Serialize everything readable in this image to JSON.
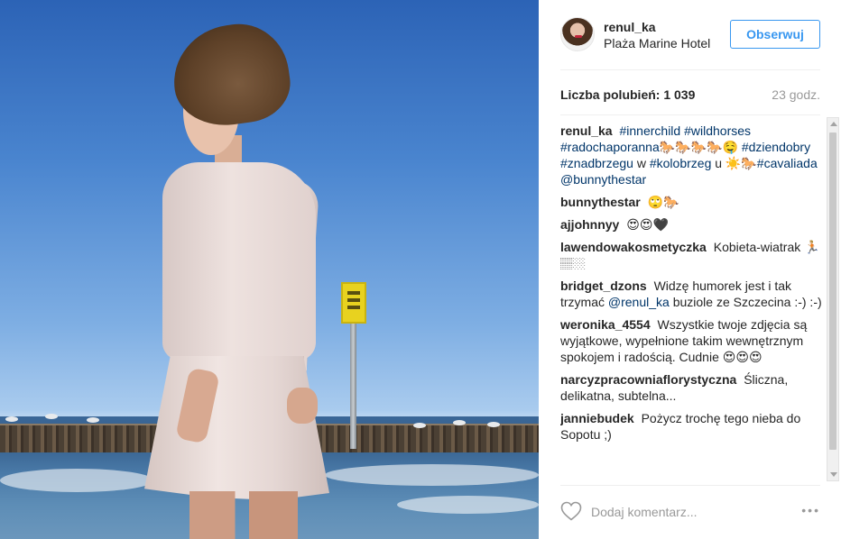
{
  "post": {
    "username": "renul_ka",
    "location": "Plaża Marine Hotel",
    "follow_label": "Obserwuj",
    "likes_text": "Liczba polubień: 1 039",
    "time_ago": "23 godz.",
    "caption": {
      "author": "renul_ka",
      "parts": [
        "#innerchild",
        "#wildhorses",
        "#radochaporanna🐎🐎🐎🐎🤤",
        "#dziendobry",
        "#znadbrzegu",
        "w",
        "#kolobrzeg",
        "u ☀️🐎",
        "#cavaliada",
        "@bunnythestar"
      ]
    }
  },
  "comments": [
    {
      "author": "bunnythestar",
      "text": "🙄🐎"
    },
    {
      "author": "ajjohnnyy",
      "text": "😍😍🖤"
    },
    {
      "author": "lawendowakosmetyczka",
      "text": "Kobieta-wiatrak 🏃🏼🏽🏼"
    },
    {
      "author": "bridget_dzons",
      "text_before": "Widzę humorek jest i tak trzymać",
      "mention": "@renul_ka",
      "text_after": "buziole ze Szczecina :-) :-)"
    },
    {
      "author": "weronika_4554",
      "text": "Wszystkie twoje zdjęcia są wyjątkowe, wypełnione takim wewnętrznym spokojem i radością. Cudnie 😍😍😍"
    },
    {
      "author": "narcyzpracowniaflorystyczna",
      "text": "Śliczna, delikatna, subtelna..."
    },
    {
      "author": "janniebudek",
      "text": "Pożycz trochę tego nieba do Sopotu ;)"
    }
  ],
  "footer": {
    "comment_placeholder": "Dodaj komentarz...",
    "more_label": "•••"
  },
  "icons": {
    "like": "heart-icon",
    "more": "more-options-icon"
  },
  "colors": {
    "link": "#003569",
    "follow_blue": "#3897f0",
    "muted": "#999999"
  }
}
